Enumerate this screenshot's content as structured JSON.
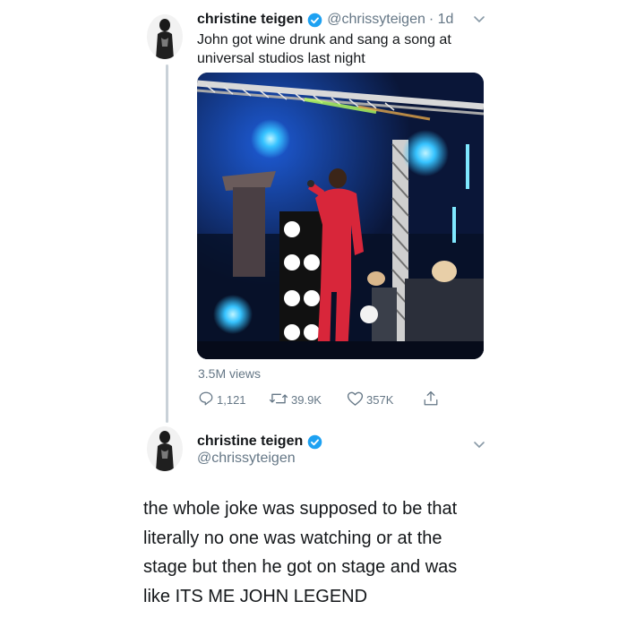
{
  "tweet1": {
    "name": "christine teigen",
    "handle": "@chrissyteigen",
    "time": "· 1d",
    "text_line1": "John got wine drunk and sang a song at",
    "text_line2": "universal studios last night",
    "views": "3.5M views",
    "replies": "1,121",
    "retweets": "39.9K",
    "likes": "357K"
  },
  "tweet2": {
    "name": "christine teigen",
    "handle": "@chrissyteigen",
    "text": [
      "the whole joke was supposed to be that",
      "literally no one was watching or at the",
      "stage but then he got on stage and was",
      "like ITS ME JOHN LEGEND"
    ]
  },
  "colors": {
    "verified": "#1da1f2",
    "muted": "#657786",
    "thread_line": "#c9d1d8",
    "stage_dark": "#0b1a3d"
  },
  "icons": [
    "avatar",
    "verified-icon",
    "chevron-down-icon",
    "reply-icon",
    "retweet-icon",
    "like-icon",
    "share-icon"
  ]
}
